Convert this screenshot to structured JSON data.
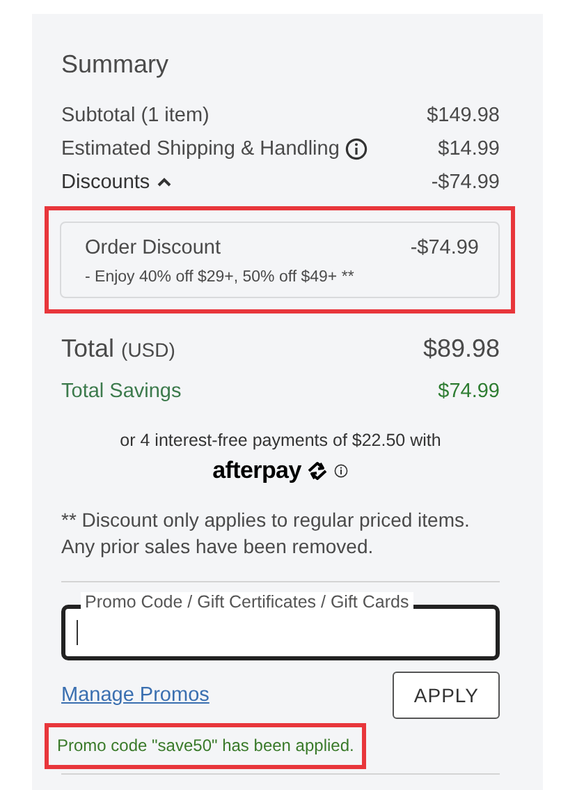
{
  "summary": {
    "title": "Summary",
    "lines": [
      {
        "label": "Subtotal (1 item)",
        "value": "$149.98",
        "kind": "plain"
      },
      {
        "label": "Estimated Shipping & Handling",
        "value": "$14.99",
        "kind": "info"
      },
      {
        "label": "Discounts",
        "value": "-$74.99",
        "kind": "toggle",
        "expanded": true
      }
    ],
    "discount": {
      "name": "Order Discount",
      "value": "-$74.99",
      "detail": "- Enjoy 40% off $29+, 50% off $49+ **",
      "highlighted": true
    },
    "total": {
      "label": "Total",
      "currency": "(USD)",
      "value": "$89.98"
    },
    "savings": {
      "label": "Total Savings",
      "value": "$74.99"
    },
    "installments": {
      "text": "or 4 interest-free payments of $22.50 with",
      "brand": "afterpay"
    },
    "note": "** Discount only applies to regular priced items. Any prior sales have been removed.",
    "promo": {
      "label": "Promo Code / Gift Certificates / Gift Cards",
      "focused": true,
      "link": "Manage Promos",
      "button": "APPLY",
      "message": "Promo code \"save50\" has been applied.",
      "highlighted": true
    }
  }
}
